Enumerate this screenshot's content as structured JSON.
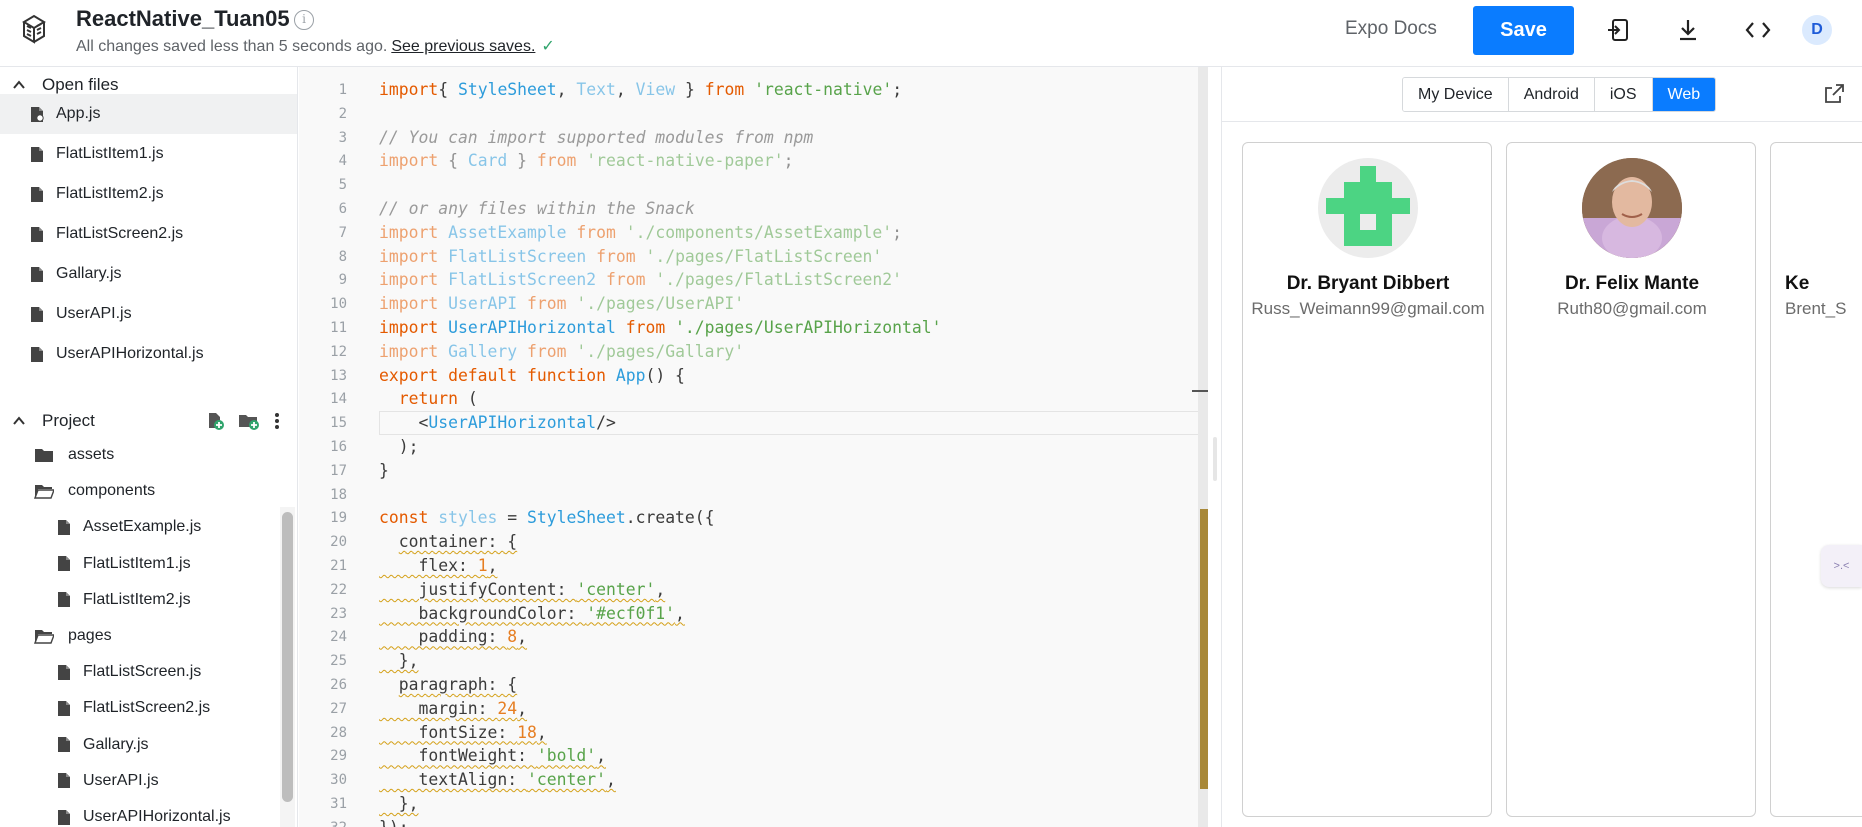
{
  "header": {
    "title": "ReactNative_Tuan05",
    "save_status": "All changes saved less than 5 seconds ago.",
    "previous_saves_link": "See previous saves.",
    "expo_docs": "Expo Docs",
    "save_label": "Save",
    "avatar_initial": "D"
  },
  "sidebar": {
    "open_files_label": "Open files",
    "open_files": [
      "App.js",
      "FlatListItem1.js",
      "FlatListItem2.js",
      "FlatListScreen2.js",
      "Gallary.js",
      "UserAPI.js",
      "UserAPIHorizontal.js"
    ],
    "active_file": "App.js",
    "project_label": "Project",
    "tree": [
      {
        "label": "assets",
        "type": "folder",
        "depth": 0
      },
      {
        "label": "components",
        "type": "folder-open",
        "depth": 0
      },
      {
        "label": "AssetExample.js",
        "type": "file",
        "depth": 1
      },
      {
        "label": "FlatListItem1.js",
        "type": "file",
        "depth": 1
      },
      {
        "label": "FlatListItem2.js",
        "type": "file",
        "depth": 1
      },
      {
        "label": "pages",
        "type": "folder-open",
        "depth": 0
      },
      {
        "label": "FlatListScreen.js",
        "type": "file",
        "depth": 1
      },
      {
        "label": "FlatListScreen2.js",
        "type": "file",
        "depth": 1
      },
      {
        "label": "Gallary.js",
        "type": "file",
        "depth": 1
      },
      {
        "label": "UserAPI.js",
        "type": "file",
        "depth": 1
      },
      {
        "label": "UserAPIHorizontal.js",
        "type": "file",
        "depth": 1
      }
    ]
  },
  "editor": {
    "active_line": 15,
    "lines": [
      [
        [
          "kw",
          "import"
        ],
        [
          "",
          "{ "
        ],
        [
          "cls",
          "StyleSheet"
        ],
        [
          "",
          ", "
        ],
        [
          "cls dim",
          "Text"
        ],
        [
          "",
          ", "
        ],
        [
          "cls dim",
          "View"
        ],
        [
          "",
          " } "
        ],
        [
          "kw",
          "from"
        ],
        [
          "",
          ""
        ],
        [
          "str",
          " 'react-native'"
        ],
        [
          "",
          ";"
        ]
      ],
      [],
      [
        [
          "cmt",
          "// You can import supported modules from npm"
        ]
      ],
      [
        [
          "kw dim",
          "import"
        ],
        [
          "dim",
          " { "
        ],
        [
          "cls dim",
          "Card"
        ],
        [
          "dim",
          " } "
        ],
        [
          "kw dim",
          "from"
        ],
        [
          "str dim",
          " 'react-native-paper'"
        ],
        [
          "dim",
          ";"
        ]
      ],
      [],
      [
        [
          "cmt",
          "// or any files within the Snack"
        ]
      ],
      [
        [
          "kw dim",
          "import"
        ],
        [
          "cls dim",
          " AssetExample"
        ],
        [
          "kw dim",
          " from"
        ],
        [
          "str dim",
          " './components/AssetExample'"
        ],
        [
          "dim",
          ";"
        ]
      ],
      [
        [
          "kw dim",
          "import"
        ],
        [
          "cls dim",
          " FlatListScreen"
        ],
        [
          "kw dim",
          " from"
        ],
        [
          "str dim",
          " './pages/FlatListScreen'"
        ]
      ],
      [
        [
          "kw dim",
          "import"
        ],
        [
          "cls dim",
          " FlatListScreen2"
        ],
        [
          "kw dim",
          " from"
        ],
        [
          "str dim",
          " './pages/FlatListScreen2'"
        ]
      ],
      [
        [
          "kw dim",
          "import"
        ],
        [
          "cls dim",
          " UserAPI"
        ],
        [
          "kw dim",
          " from"
        ],
        [
          "str dim",
          " './pages/UserAPI'"
        ]
      ],
      [
        [
          "kw",
          "import"
        ],
        [
          "cls",
          " UserAPIHorizontal"
        ],
        [
          "kw",
          " from"
        ],
        [
          "str",
          " './pages/UserAPIHorizontal'"
        ]
      ],
      [
        [
          "kw dim",
          "import"
        ],
        [
          "cls dim",
          " Gallery"
        ],
        [
          "kw dim",
          " from"
        ],
        [
          "str dim",
          " './pages/Gallary'"
        ]
      ],
      [
        [
          "kw",
          "export default function"
        ],
        [
          "fn",
          " App"
        ],
        [
          "",
          "() {"
        ]
      ],
      [
        [
          "",
          "  "
        ],
        [
          "kw",
          "return"
        ],
        [
          "",
          " ("
        ]
      ],
      [
        [
          "",
          "    <"
        ],
        [
          "cls",
          "UserAPIHorizontal"
        ],
        [
          "",
          "/>"
        ]
      ],
      [
        [
          "",
          "  );"
        ]
      ],
      [
        [
          "",
          "}"
        ]
      ],
      [],
      [
        [
          "kw",
          "const"
        ],
        [
          "cls dim",
          " styles"
        ],
        [
          "",
          " = "
        ],
        [
          "cls",
          "StyleSheet"
        ],
        [
          "",
          ".create({"
        ]
      ],
      [
        [
          "",
          "  "
        ],
        [
          "squig",
          "container: {"
        ]
      ],
      [
        [
          "squig",
          "    flex: "
        ],
        [
          "num squig",
          "1"
        ],
        [
          "squig",
          ","
        ]
      ],
      [
        [
          "squig",
          "    justifyContent: "
        ],
        [
          "str squig",
          "'center'"
        ],
        [
          "squig",
          ","
        ]
      ],
      [
        [
          "squig",
          "    backgroundColor: "
        ],
        [
          "str squig",
          "'#ecf0f1'"
        ],
        [
          "squig",
          ","
        ]
      ],
      [
        [
          "squig",
          "    padding: "
        ],
        [
          "num squig",
          "8"
        ],
        [
          "squig",
          ","
        ]
      ],
      [
        [
          "squig",
          "  },"
        ]
      ],
      [
        [
          "",
          "  "
        ],
        [
          "squig",
          "paragraph: {"
        ]
      ],
      [
        [
          "squig",
          "    margin: "
        ],
        [
          "num squig",
          "24"
        ],
        [
          "squig",
          ","
        ]
      ],
      [
        [
          "squig",
          "    fontSize: "
        ],
        [
          "num squig",
          "18"
        ],
        [
          "squig",
          ","
        ]
      ],
      [
        [
          "squig",
          "    fontWeight: "
        ],
        [
          "str squig",
          "'bold'"
        ],
        [
          "squig",
          ","
        ]
      ],
      [
        [
          "squig",
          "    textAlign: "
        ],
        [
          "str squig",
          "'center'"
        ],
        [
          "squig",
          ","
        ]
      ],
      [
        [
          "squig",
          "  },"
        ]
      ],
      [
        [
          "",
          "});"
        ]
      ]
    ]
  },
  "preview": {
    "tabs": [
      "My Device",
      "Android",
      "iOS",
      "Web"
    ],
    "active_tab": "Web",
    "cards": [
      {
        "name": "Dr. Bryant Dibbert",
        "email": "Russ_Weimann99@gmail.com",
        "avatar": "identicon"
      },
      {
        "name": "Dr. Felix Mante",
        "email": "Ruth80@gmail.com",
        "avatar": "photo"
      },
      {
        "name": "Ke",
        "email": "Brent_S",
        "avatar": "none"
      }
    ],
    "float_label": ">.<"
  },
  "colors": {
    "accent": "#0a7cff",
    "identicon": "#4cd483",
    "keyword": "#e45a00",
    "string": "#58a34a",
    "class": "#2d9cdb"
  }
}
